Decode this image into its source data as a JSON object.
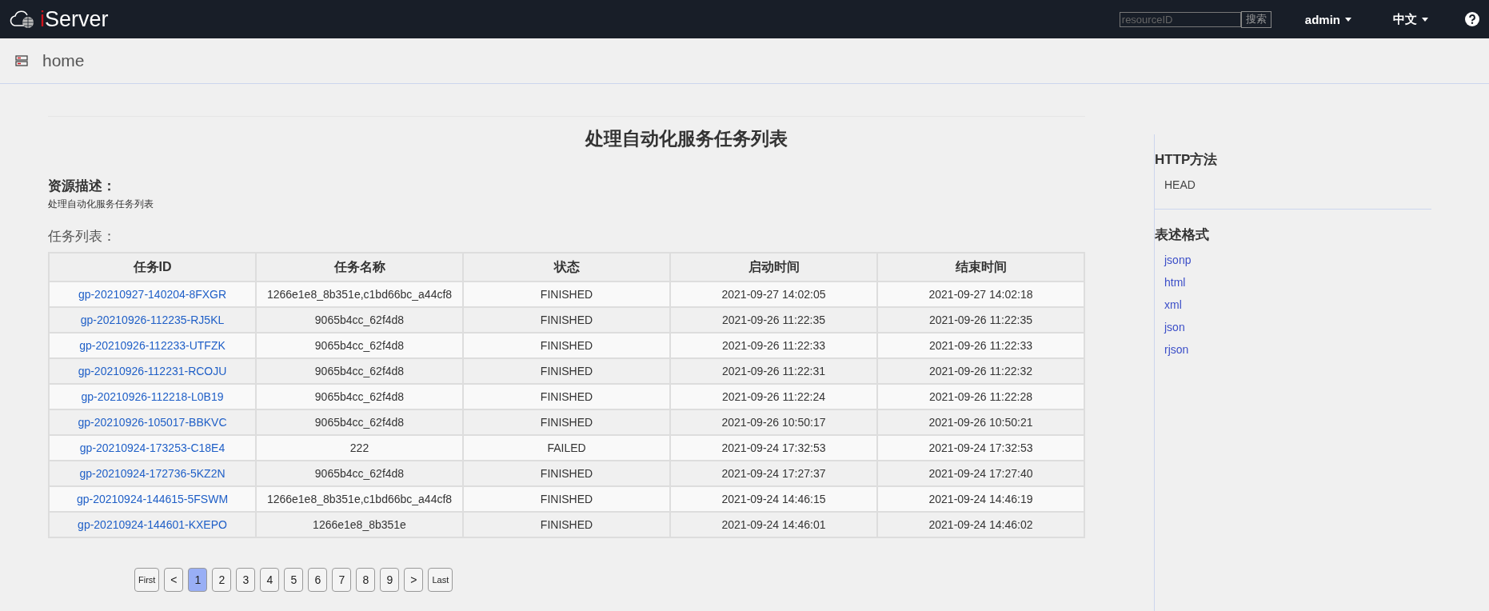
{
  "topbar": {
    "logo": "iServer",
    "search": {
      "placeholder": "resourceID",
      "button": "搜索"
    },
    "user_menu": "admin",
    "language_menu": "中文"
  },
  "breadcrumb": {
    "label": "home"
  },
  "page_title": "处理自动化服务任务列表",
  "description": {
    "heading": "资源描述：",
    "text": "处理自动化服务任务列表"
  },
  "task_list": {
    "heading": "任务列表：",
    "columns": [
      "任务ID",
      "任务名称",
      "状态",
      "启动时间",
      "结束时间"
    ],
    "rows": [
      {
        "id": "gp-20210927-140204-8FXGR",
        "name": "1266e1e8_8b351e,c1bd66bc_a44cf8",
        "status": "FINISHED",
        "start": "2021-09-27 14:02:05",
        "end": "2021-09-27 14:02:18"
      },
      {
        "id": "gp-20210926-112235-RJ5KL",
        "name": "9065b4cc_62f4d8",
        "status": "FINISHED",
        "start": "2021-09-26 11:22:35",
        "end": "2021-09-26 11:22:35"
      },
      {
        "id": "gp-20210926-112233-UTFZK",
        "name": "9065b4cc_62f4d8",
        "status": "FINISHED",
        "start": "2021-09-26 11:22:33",
        "end": "2021-09-26 11:22:33"
      },
      {
        "id": "gp-20210926-112231-RCOJU",
        "name": "9065b4cc_62f4d8",
        "status": "FINISHED",
        "start": "2021-09-26 11:22:31",
        "end": "2021-09-26 11:22:32"
      },
      {
        "id": "gp-20210926-112218-L0B19",
        "name": "9065b4cc_62f4d8",
        "status": "FINISHED",
        "start": "2021-09-26 11:22:24",
        "end": "2021-09-26 11:22:28"
      },
      {
        "id": "gp-20210926-105017-BBKVC",
        "name": "9065b4cc_62f4d8",
        "status": "FINISHED",
        "start": "2021-09-26 10:50:17",
        "end": "2021-09-26 10:50:21"
      },
      {
        "id": "gp-20210924-173253-C18E4",
        "name": "222",
        "status": "FAILED",
        "start": "2021-09-24 17:32:53",
        "end": "2021-09-24 17:32:53"
      },
      {
        "id": "gp-20210924-172736-5KZ2N",
        "name": "9065b4cc_62f4d8",
        "status": "FINISHED",
        "start": "2021-09-24 17:27:37",
        "end": "2021-09-24 17:27:40"
      },
      {
        "id": "gp-20210924-144615-5FSWM",
        "name": "1266e1e8_8b351e,c1bd66bc_a44cf8",
        "status": "FINISHED",
        "start": "2021-09-24 14:46:15",
        "end": "2021-09-24 14:46:19"
      },
      {
        "id": "gp-20210924-144601-KXEPO",
        "name": "1266e1e8_8b351e",
        "status": "FINISHED",
        "start": "2021-09-24 14:46:01",
        "end": "2021-09-24 14:46:02"
      }
    ]
  },
  "pagination": {
    "first": "First",
    "prev": "<",
    "pages": [
      {
        "label": "1",
        "selected": true
      },
      {
        "label": "2",
        "selected": false
      },
      {
        "label": "3",
        "selected": false
      },
      {
        "label": "4",
        "selected": false
      },
      {
        "label": "5",
        "selected": false
      },
      {
        "label": "6",
        "selected": false
      },
      {
        "label": "7",
        "selected": false
      },
      {
        "label": "8",
        "selected": false
      },
      {
        "label": "9",
        "selected": false
      }
    ],
    "next": ">",
    "last": "Last"
  },
  "sidebar": {
    "http_methods": {
      "heading": "HTTP方法",
      "items": [
        "HEAD"
      ]
    },
    "formats": {
      "heading": "表述格式",
      "items": [
        "jsonp",
        "html",
        "xml",
        "json",
        "rjson"
      ]
    }
  }
}
